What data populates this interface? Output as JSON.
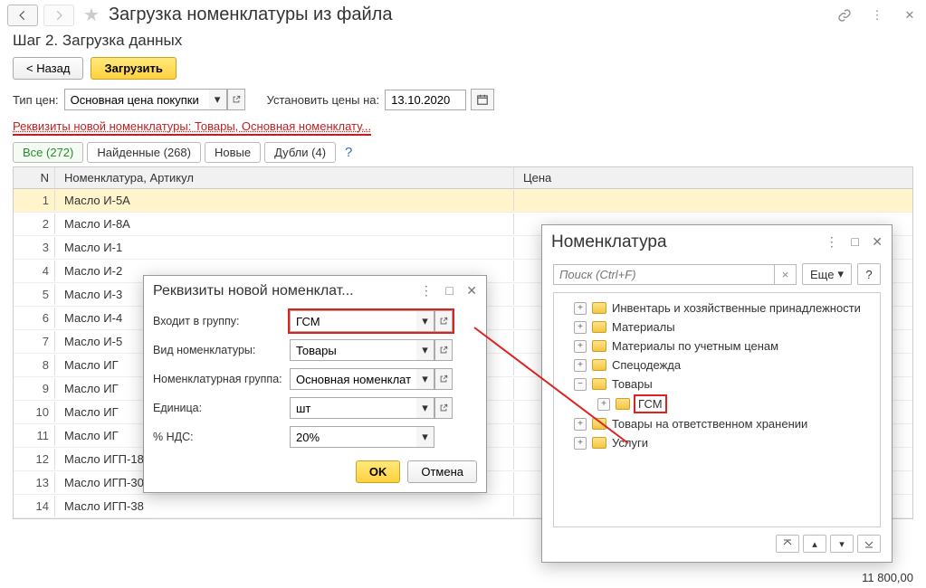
{
  "window": {
    "title": "Загрузка номенклатуры из файла",
    "step_title": "Шаг 2. Загрузка данных"
  },
  "toolbar": {
    "back": "< Назад",
    "load": "Загрузить"
  },
  "price_row": {
    "type_label": "Тип цен:",
    "type_value": "Основная цена покупки",
    "set_label": "Установить цены на:",
    "date": "13.10.2020"
  },
  "link_text": "Реквизиты новой номенклатуры: Товары, Основная номенклату...",
  "tabs": [
    {
      "label": "Все (272)",
      "active": true
    },
    {
      "label": "Найденные (268)",
      "active": false
    },
    {
      "label": "Новые",
      "active": false
    },
    {
      "label": "Дубли (4)",
      "active": false
    }
  ],
  "help": "?",
  "grid": {
    "head_n": "N",
    "head_name": "Номенклатура, Артикул",
    "head_price": "Цена",
    "rows": [
      {
        "n": 1,
        "name": "Масло И-5А",
        "sel": true
      },
      {
        "n": 2,
        "name": "Масло И-8А"
      },
      {
        "n": 3,
        "name": "Масло И-1"
      },
      {
        "n": 4,
        "name": "Масло И-2"
      },
      {
        "n": 5,
        "name": "Масло И-3"
      },
      {
        "n": 6,
        "name": "Масло И-4"
      },
      {
        "n": 7,
        "name": "Масло И-5"
      },
      {
        "n": 8,
        "name": "Масло ИГ"
      },
      {
        "n": 9,
        "name": "Масло ИГ"
      },
      {
        "n": 10,
        "name": "Масло ИГ"
      },
      {
        "n": 11,
        "name": "Масло ИГ"
      },
      {
        "n": 12,
        "name": "Масло ИГП-18"
      },
      {
        "n": 13,
        "name": "Масло ИГП-30"
      },
      {
        "n": 14,
        "name": "Масло ИГП-38"
      }
    ],
    "footer_price": "11 800,00"
  },
  "dlg1": {
    "title": "Реквизиты новой номенклат...",
    "group_label": "Входит в группу:",
    "group_value": "ГСМ",
    "kind_label": "Вид номенклатуры:",
    "kind_value": "Товары",
    "ngroup_label": "Номенклатурная группа:",
    "ngroup_value": "Основная номенклатурна",
    "unit_label": "Единица:",
    "unit_value": "шт",
    "vat_label": "% НДС:",
    "vat_value": "20%",
    "ok": "OK",
    "cancel": "Отмена"
  },
  "dlg2": {
    "title": "Номенклатура",
    "search_placeholder": "Поиск (Ctrl+F)",
    "more": "Еще",
    "help": "?",
    "tree": [
      {
        "label": "Инвентарь и хозяйственные принадлежности",
        "depth": 1,
        "exp": "+"
      },
      {
        "label": "Материалы",
        "depth": 1,
        "exp": "+"
      },
      {
        "label": "Материалы по учетным ценам",
        "depth": 1,
        "exp": "+"
      },
      {
        "label": "Спецодежда",
        "depth": 1,
        "exp": "+"
      },
      {
        "label": "Товары",
        "depth": 1,
        "exp": "−"
      },
      {
        "label": "ГСМ",
        "depth": 2,
        "exp": "+",
        "hl": true
      },
      {
        "label": "Товары на ответственном хранении",
        "depth": 1,
        "exp": "+"
      },
      {
        "label": "Услуги",
        "depth": 1,
        "exp": "+"
      }
    ]
  }
}
